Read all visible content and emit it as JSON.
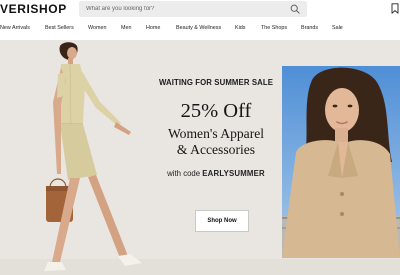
{
  "header": {
    "logo": "VERISHOP",
    "search_placeholder": "What are you looking for?"
  },
  "nav": {
    "items": [
      {
        "label": "New Arrivals"
      },
      {
        "label": "Best Sellers"
      },
      {
        "label": "Women"
      },
      {
        "label": "Men"
      },
      {
        "label": "Home"
      },
      {
        "label": "Beauty & Wellness"
      },
      {
        "label": "Kids"
      },
      {
        "label": "The Shops"
      },
      {
        "label": "Brands"
      },
      {
        "label": "Sale"
      }
    ]
  },
  "hero": {
    "eyebrow": "WAITING FOR SUMMER SALE",
    "title": "25% Off",
    "subtitle_line1": "Women's Apparel",
    "subtitle_line2": "& Accessories",
    "code_prefix": "with code ",
    "code": "EARLYSUMMER",
    "cta_label": "Shop Now"
  },
  "colors": {
    "hero_background": "#e9e6e1",
    "search_background": "#ececec",
    "button_background": "#ffffff",
    "text": "#111111"
  },
  "icons": {
    "search": "search-icon",
    "bookmark": "bookmark-icon"
  }
}
